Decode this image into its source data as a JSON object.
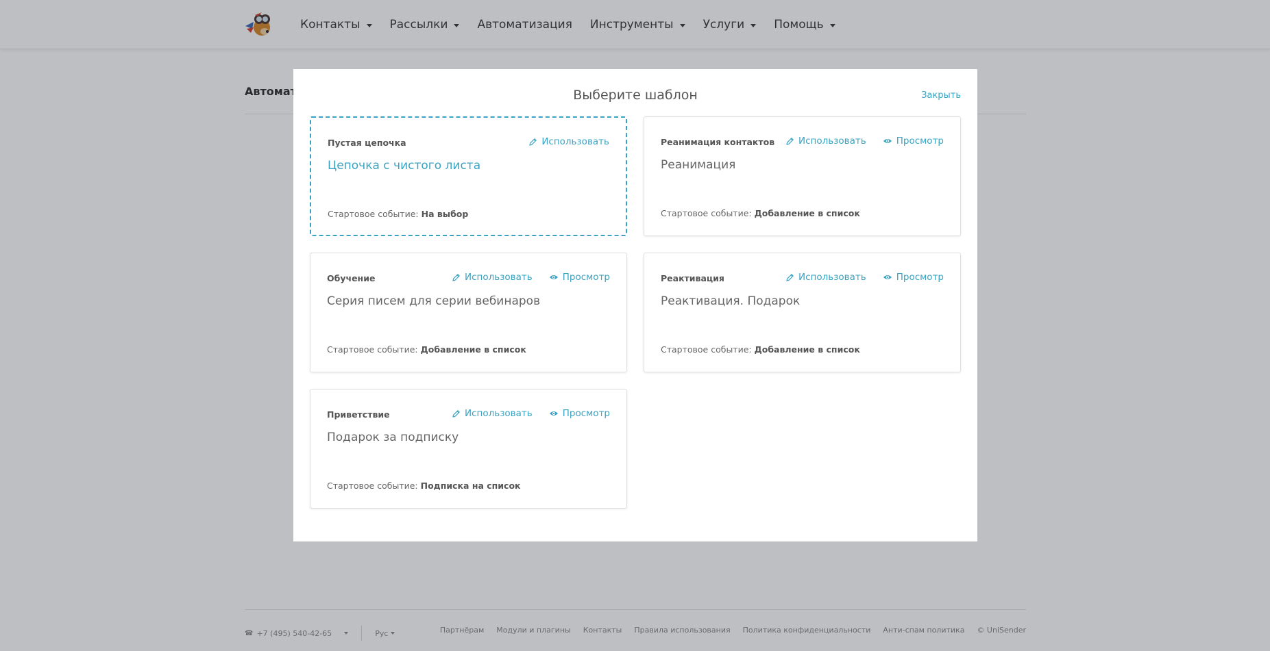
{
  "nav": {
    "items": [
      {
        "label": "Контакты",
        "dropdown": true
      },
      {
        "label": "Рассылки",
        "dropdown": true
      },
      {
        "label": "Автоматизация",
        "dropdown": false
      },
      {
        "label": "Инструменты",
        "dropdown": true
      },
      {
        "label": "Услуги",
        "dropdown": true
      },
      {
        "label": "Помощь",
        "dropdown": true
      }
    ]
  },
  "page": {
    "title": "Автоматизация"
  },
  "modal": {
    "title": "Выберите шаблон",
    "close_label": "Закрыть",
    "use_label": "Использовать",
    "preview_label": "Просмотр",
    "start_prefix": "Стартовое событие:",
    "templates": [
      {
        "category": "Пустая цепочка",
        "name": "Цепочка с чистого листа",
        "start_event": "На выбор",
        "has_preview": false
      },
      {
        "category": "Реанимация контактов",
        "name": "Реанимация",
        "start_event": "Добавление в список",
        "has_preview": true
      },
      {
        "category": "Обучение",
        "name": "Серия писем для серии вебинаров",
        "start_event": "Добавление в список",
        "has_preview": true
      },
      {
        "category": "Реактивация",
        "name": "Реактивация. Подарок",
        "start_event": "Добавление в список",
        "has_preview": true
      },
      {
        "category": "Приветствие",
        "name": "Подарок за подписку",
        "start_event": "Подписка на список",
        "has_preview": true
      }
    ]
  },
  "footer": {
    "phone": "+7 (495) 540-42-65",
    "language": "Рус",
    "links": [
      "Партнёрам",
      "Модули и плагины",
      "Контакты",
      "Правила использования",
      "Политика конфиденциальности",
      "Анти-спам политика"
    ],
    "copyright": "© UniSender"
  },
  "colors": {
    "accent": "#3aa3c3",
    "overlay": "rgba(20,24,40,0.28)"
  }
}
